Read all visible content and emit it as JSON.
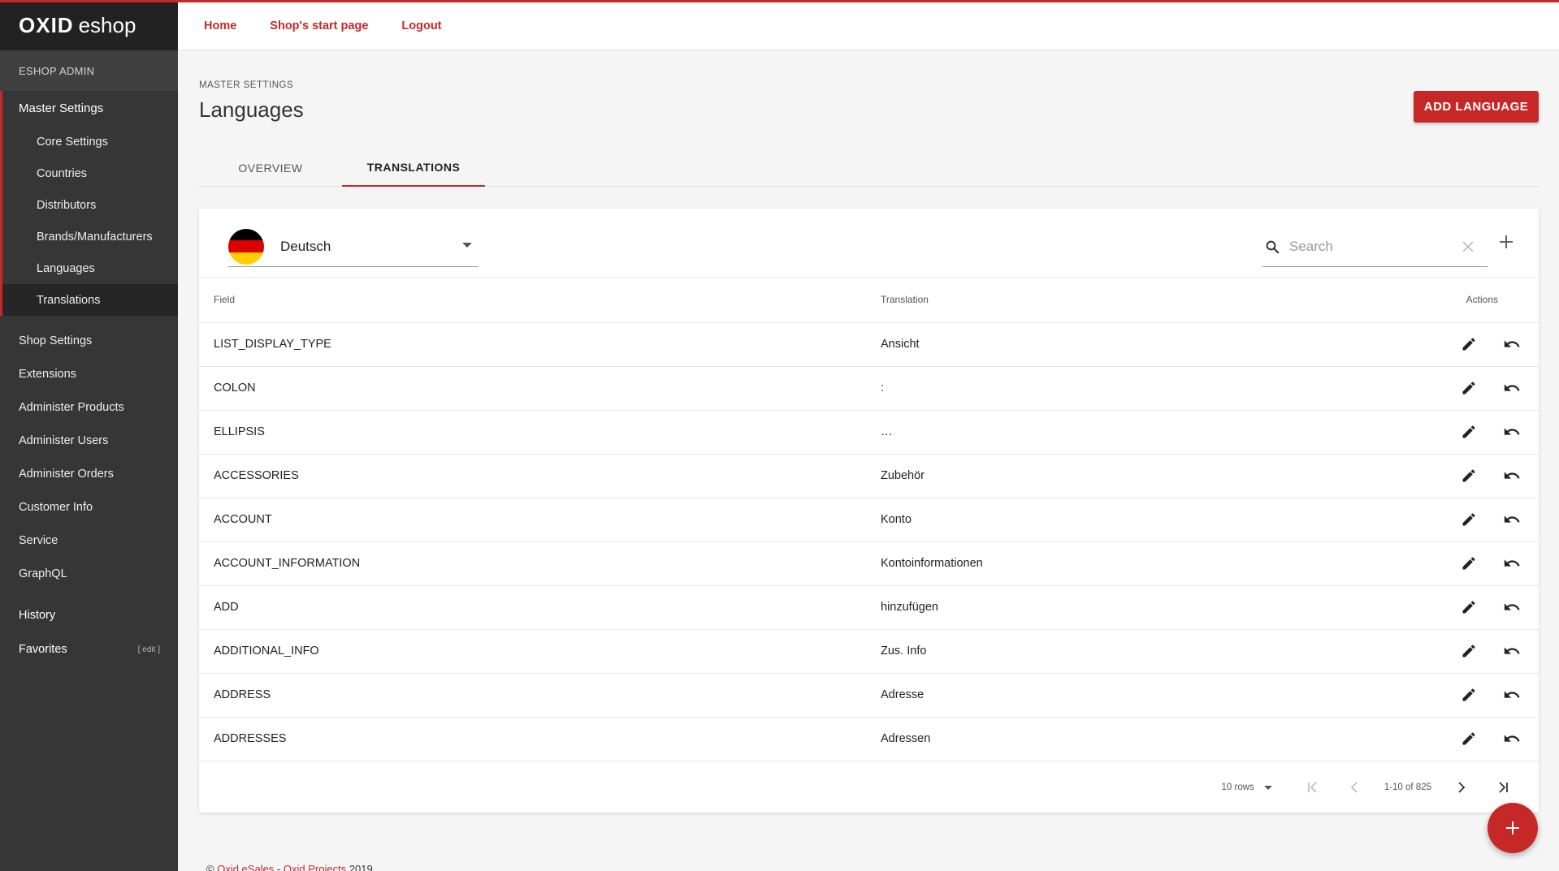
{
  "brand": {
    "strong": "OXID",
    "light": "eshop"
  },
  "sidebar": {
    "title": "ESHOP ADMIN",
    "master": {
      "label": "Master Settings",
      "items": [
        "Core Settings",
        "Countries",
        "Distributors",
        "Brands/Manufacturers",
        "Languages",
        "Translations"
      ],
      "active_index": 5
    },
    "main_items": [
      "Shop Settings",
      "Extensions",
      "Administer Products",
      "Administer Users",
      "Administer Orders",
      "Customer Info",
      "Service",
      "GraphQL"
    ],
    "history_label": "History",
    "favorites_label": "Favorites",
    "favorites_edit": "[ edit ]"
  },
  "topnav": {
    "home": "Home",
    "shop_start": "Shop's start page",
    "logout": "Logout"
  },
  "page": {
    "breadcrumb": "MASTER SETTINGS",
    "title": "Languages",
    "add_button": "ADD LANGUAGE",
    "tabs": [
      {
        "label": "OVERVIEW",
        "active": false
      },
      {
        "label": "TRANSLATIONS",
        "active": true
      }
    ]
  },
  "toolbar": {
    "language": "Deutsch",
    "flag_colors": [
      "#000000",
      "#dd0000",
      "#ffce00"
    ],
    "search_placeholder": "Search",
    "search_value": ""
  },
  "table": {
    "headers": {
      "field": "Field",
      "translation": "Translation",
      "actions": "Actions"
    },
    "rows": [
      {
        "field": "LIST_DISPLAY_TYPE",
        "translation": "Ansicht"
      },
      {
        "field": "COLON",
        "translation": ":"
      },
      {
        "field": "ELLIPSIS",
        "translation": "…"
      },
      {
        "field": "ACCESSORIES",
        "translation": "Zubehör"
      },
      {
        "field": "ACCOUNT",
        "translation": "Konto"
      },
      {
        "field": "ACCOUNT_INFORMATION",
        "translation": "Kontoinformationen"
      },
      {
        "field": "ADD",
        "translation": "hinzufügen"
      },
      {
        "field": "ADDITIONAL_INFO",
        "translation": "Zus. Info"
      },
      {
        "field": "ADDRESS",
        "translation": "Adresse"
      },
      {
        "field": "ADDRESSES",
        "translation": "Adressen"
      }
    ]
  },
  "pager": {
    "rows_per_page": "10 rows",
    "range": "1-10 of 825"
  },
  "footer": {
    "prefix": "©",
    "company": "Oxid eSales",
    "separator": " - ",
    "projects": "Oxid Projects",
    "year": "2019"
  },
  "colors": {
    "accent": "#c62828",
    "sidebar_bg": "#363636",
    "logo_bg": "#222222"
  }
}
